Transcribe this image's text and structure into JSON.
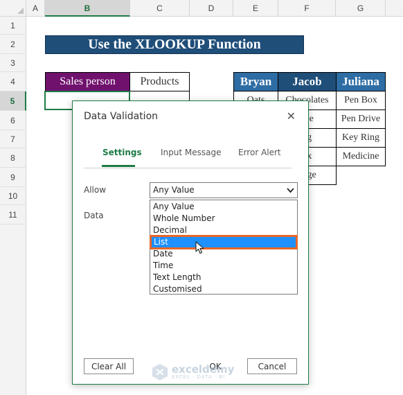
{
  "sheet": {
    "columns": [
      "A",
      "B",
      "C",
      "D",
      "E",
      "F",
      "G"
    ],
    "rows": [
      "1",
      "2",
      "3",
      "4",
      "5",
      "6",
      "7",
      "8",
      "9",
      "10",
      "11"
    ],
    "active_column": "B",
    "active_row": "5",
    "title": "Use the XLOOKUP Function",
    "table_left": {
      "header_sales": "Sales person",
      "header_products": "Products"
    },
    "table_right": {
      "headers": [
        "Bryan",
        "Jacob",
        "Juliana"
      ],
      "col_e": [
        "Oats"
      ],
      "col_f": [
        "Chocolates",
        "use",
        "ag",
        "ox",
        "page"
      ],
      "col_g": [
        "Pen Box",
        "Pen Drive",
        "Key Ring",
        "Medicine"
      ]
    }
  },
  "dialog": {
    "title": "Data Validation",
    "close_symbol": "✕",
    "tabs": [
      {
        "label": "Settings",
        "active": true
      },
      {
        "label": "Input Message",
        "active": false
      },
      {
        "label": "Error Alert",
        "active": false
      }
    ],
    "allow_label": "Allow",
    "allow_value": "Any Value",
    "data_label": "Data",
    "options": [
      "Any Value",
      "Whole Number",
      "Decimal",
      "List",
      "Date",
      "Time",
      "Text Length",
      "Customised"
    ],
    "highlighted_option": "List",
    "buttons": {
      "clear_all": "Clear All",
      "ok": "OK",
      "cancel": "Cancel"
    }
  },
  "watermark": {
    "name": "exceldemy",
    "tagline": "EXCEL · DATA · BI"
  },
  "colors": {
    "excel_green": "#1e7a45",
    "title_navy": "#1f4e79",
    "header_purple": "#70116d",
    "header_blue": "#2e6da4",
    "selection_blue": "#1e90ff",
    "highlight_orange": "#e8672a"
  },
  "icons": {
    "dropdown": "chevron-down-icon",
    "close": "close-icon",
    "cursor": "mouse-pointer-icon",
    "watermark_logo": "exceldemy-logo-icon"
  }
}
